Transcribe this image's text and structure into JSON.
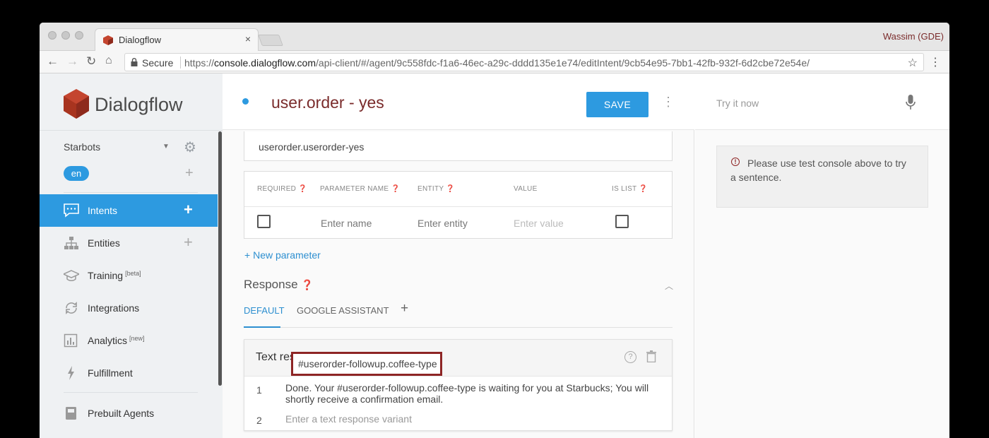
{
  "browser": {
    "tab_title": "Dialogflow",
    "tab_close": "×",
    "profile": "Wassim (GDE)",
    "secure_label": "Secure",
    "url_prefix": "https://",
    "url_domain": "console.dialogflow.com",
    "url_path": "/api-client/#/agent/9c558fdc-f1a6-46ec-a29c-dddd135e1e74/editIntent/9cb54e95-7bb1-42fb-932f-6d2cbe72e54e/"
  },
  "sidebar": {
    "brand": "Dialogflow",
    "agent_name": "Starbots",
    "language": "en",
    "items": [
      {
        "label": "Intents",
        "icon": "chat-bubble-icon",
        "active": true,
        "has_add": true
      },
      {
        "label": "Entities",
        "icon": "hierarchy-icon",
        "has_add": true
      },
      {
        "label": "Training",
        "sup": "[beta]",
        "icon": "graduation-cap-icon"
      },
      {
        "label": "Integrations",
        "icon": "sync-icon"
      },
      {
        "label": "Analytics",
        "sup": "[new]",
        "icon": "bar-chart-icon"
      },
      {
        "label": "Fulfillment",
        "icon": "lightning-icon"
      },
      {
        "label": "Prebuilt Agents",
        "icon": "book-icon"
      }
    ]
  },
  "intent": {
    "title": "user.order - yes",
    "save_label": "SAVE",
    "context_value": "userorder.userorder-yes"
  },
  "params": {
    "headers": [
      "REQUIRED",
      "PARAMETER NAME",
      "ENTITY",
      "VALUE",
      "IS LIST"
    ],
    "name_placeholder": "Enter name",
    "entity_placeholder": "Enter entity",
    "value_placeholder": "Enter value",
    "new_param_label": "New parameter"
  },
  "response": {
    "title": "Response",
    "tabs": [
      "DEFAULT",
      "GOOGLE ASSISTANT"
    ],
    "card_title": "Text response",
    "rows": [
      {
        "num": "1",
        "text": "Done. Your #userorder-followup.coffee-type is waiting for you at Starbucks; You will shortly receive a confirmation email."
      },
      {
        "num": "2",
        "placeholder": "Enter a text response variant"
      }
    ],
    "highlight_text": "#userorder-followup.coffee-type"
  },
  "console": {
    "placeholder": "Try it now",
    "notice": "Please use test console above to try a sentence."
  },
  "colors": {
    "accent": "#2d9ae0",
    "brand_red": "#7a2b2b",
    "highlight_border": "#8e2525"
  }
}
